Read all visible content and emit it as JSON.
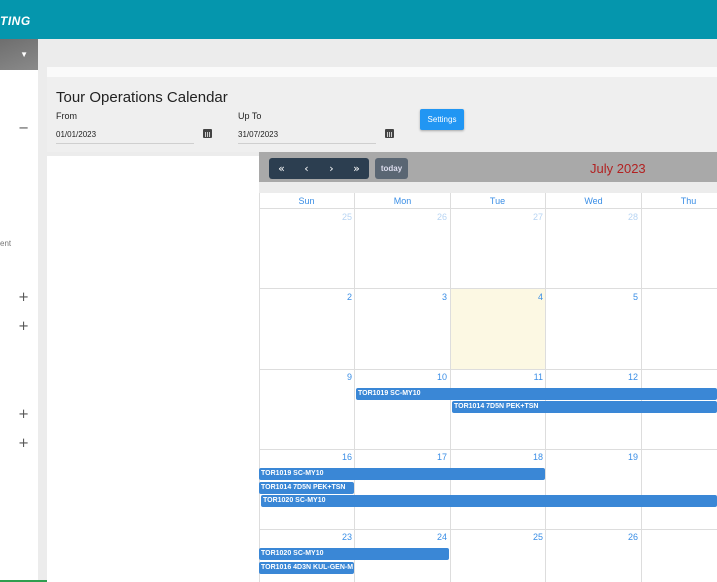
{
  "brand": {
    "text": "TING"
  },
  "form": {
    "title": "Tour Operations Calendar",
    "from_label": "From",
    "from_value": "01/01/2023",
    "to_label": "Up To",
    "to_value": "31/07/2023",
    "settings_label": "Settings"
  },
  "sidebar": {
    "text_fragment": "ent",
    "icons": [
      "minus-icon",
      "plus-icon",
      "plus-icon",
      "plus-icon",
      "plus-icon"
    ]
  },
  "calendar": {
    "nav": {
      "first": "«",
      "prev": "‹",
      "next": "›",
      "last": "»",
      "today": "today"
    },
    "month_title": "July 2023",
    "weekdays": [
      "Sun",
      "Mon",
      "Tue",
      "Wed",
      "Thu"
    ],
    "weeks": [
      [
        "25",
        "26",
        "27",
        "28",
        ""
      ],
      [
        "2",
        "3",
        "4",
        "5",
        ""
      ],
      [
        "9",
        "10",
        "11",
        "12",
        ""
      ],
      [
        "16",
        "17",
        "18",
        "19",
        ""
      ],
      [
        "23",
        "24",
        "25",
        "26",
        ""
      ]
    ],
    "events": {
      "e1": "TOR1019 SC-MY10",
      "e2": "TOR1014 7D5N PEK+TSN",
      "e3": "TOR1019 SC-MY10",
      "e4": "TOR1014 7D5N PEK+TSN",
      "e5": "TOR1020 SC-MY10",
      "e6": "TOR1020 SC-MY10",
      "e7": "TOR1016 4D3N KUL-GEN-M"
    },
    "colors": {
      "event": "#3a87d6",
      "today": "#fcf8e3",
      "title": "#b22222",
      "nav": "#2c3e50"
    }
  }
}
